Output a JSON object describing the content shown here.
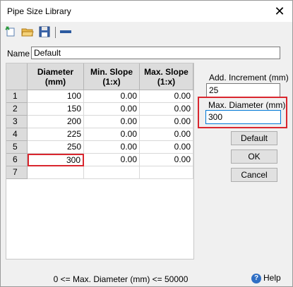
{
  "window": {
    "title": "Pipe Size Library",
    "close_glyph": "✕"
  },
  "toolbar": {
    "icons": [
      "new-icon",
      "open-folder-icon",
      "save-icon",
      "remove-row-icon"
    ]
  },
  "name": {
    "label": "Name",
    "value": "Default"
  },
  "grid": {
    "columns": [
      {
        "line1": "Diameter",
        "line2": "(mm)"
      },
      {
        "line1": "Min. Slope",
        "line2": "(1:x)"
      },
      {
        "line1": "Max. Slope",
        "line2": "(1:x)"
      }
    ],
    "rows": [
      {
        "num": "1",
        "diameter": "100",
        "min": "0.00",
        "max": "0.00"
      },
      {
        "num": "2",
        "diameter": "150",
        "min": "0.00",
        "max": "0.00"
      },
      {
        "num": "3",
        "diameter": "200",
        "min": "0.00",
        "max": "0.00"
      },
      {
        "num": "4",
        "diameter": "225",
        "min": "0.00",
        "max": "0.00"
      },
      {
        "num": "5",
        "diameter": "250",
        "min": "0.00",
        "max": "0.00"
      },
      {
        "num": "6",
        "diameter": "300",
        "min": "0.00",
        "max": "0.00"
      },
      {
        "num": "7",
        "diameter": "",
        "min": "",
        "max": ""
      }
    ]
  },
  "add_increment": {
    "label": "Add. Increment (mm)",
    "value": "25"
  },
  "max_diameter": {
    "label": "Max. Diameter (mm)",
    "value": "300"
  },
  "buttons": {
    "default": "Default",
    "ok": "OK",
    "cancel": "Cancel"
  },
  "status": "0 <= Max. Diameter (mm) <= 50000",
  "help": "Help",
  "colors": {
    "highlight": "#d9262e",
    "focus": "#0078d7"
  }
}
